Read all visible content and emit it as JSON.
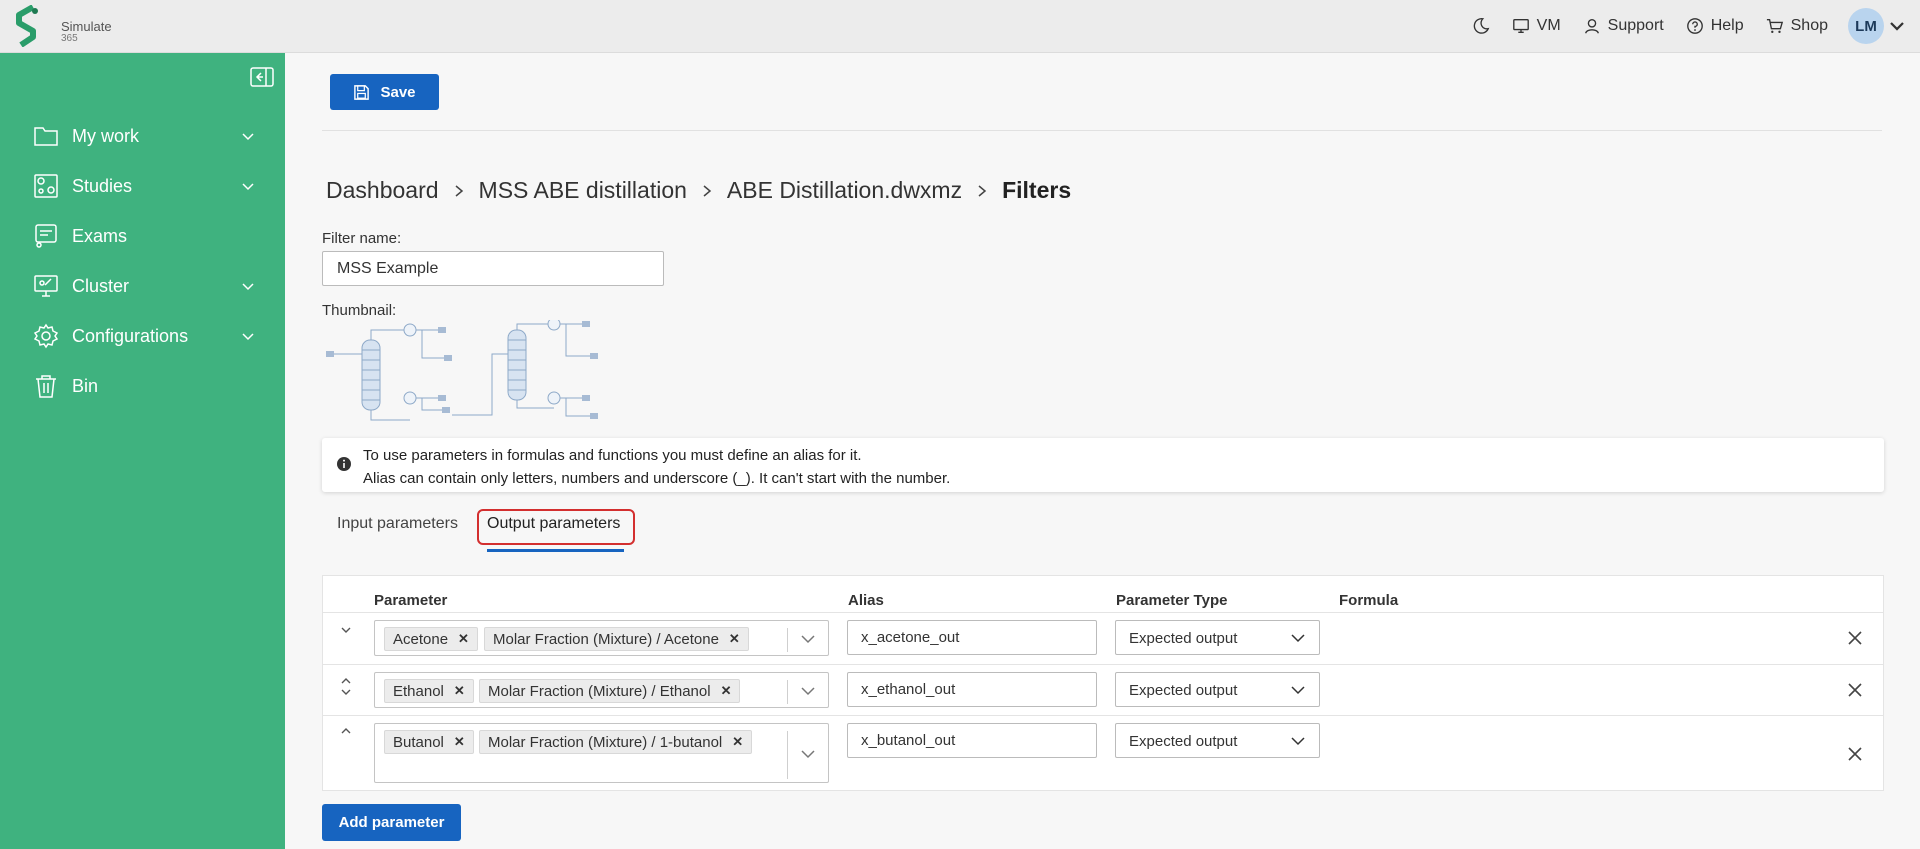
{
  "app": {
    "logo_name": "Simulate",
    "logo_sub": "365"
  },
  "topnav": {
    "theme_icon": "moon-icon",
    "vm": "VM",
    "support": "Support",
    "help": "Help",
    "shop": "Shop",
    "avatar": "LM"
  },
  "sidebar": {
    "items": [
      {
        "label": "My work",
        "icon": "folder-icon",
        "expandable": true
      },
      {
        "label": "Studies",
        "icon": "studies-icon",
        "expandable": true
      },
      {
        "label": "Exams",
        "icon": "exams-icon",
        "expandable": false
      },
      {
        "label": "Cluster",
        "icon": "cluster-icon",
        "expandable": true
      },
      {
        "label": "Configurations",
        "icon": "gear-icon",
        "expandable": true
      },
      {
        "label": "Bin",
        "icon": "trash-icon",
        "expandable": false
      }
    ]
  },
  "toolbar": {
    "save_label": "Save"
  },
  "breadcrumb": [
    "Dashboard",
    "MSS ABE distillation",
    "ABE Distillation.dwxmz",
    "Filters"
  ],
  "form": {
    "filter_name_label": "Filter name:",
    "filter_name_value": "MSS Example",
    "thumbnail_label": "Thumbnail:"
  },
  "info": {
    "line1": "To use parameters in formulas and functions you must define an alias for it.",
    "line2": "Alias can contain only letters, numbers and underscore (_). It can't start with the number."
  },
  "tabs": {
    "input": "Input parameters",
    "output": "Output parameters",
    "active": "output"
  },
  "table": {
    "headers": {
      "parameter": "Parameter",
      "alias": "Alias",
      "type": "Parameter Type",
      "formula": "Formula"
    },
    "rows": [
      {
        "tags": [
          "Acetone",
          "Molar Fraction (Mixture) / Acetone"
        ],
        "alias": "x_acetone_out",
        "type": "Expected output"
      },
      {
        "tags": [
          "Ethanol",
          "Molar Fraction (Mixture) / Ethanol"
        ],
        "alias": "x_ethanol_out",
        "type": "Expected output"
      },
      {
        "tags": [
          "Butanol",
          "Molar Fraction (Mixture) / 1-butanol"
        ],
        "alias": "x_butanol_out",
        "type": "Expected output"
      }
    ]
  },
  "add_parameter_label": "Add parameter",
  "colors": {
    "sidebar": "#3fb27f",
    "primary": "#1764c0",
    "highlight": "#d32f2f"
  }
}
